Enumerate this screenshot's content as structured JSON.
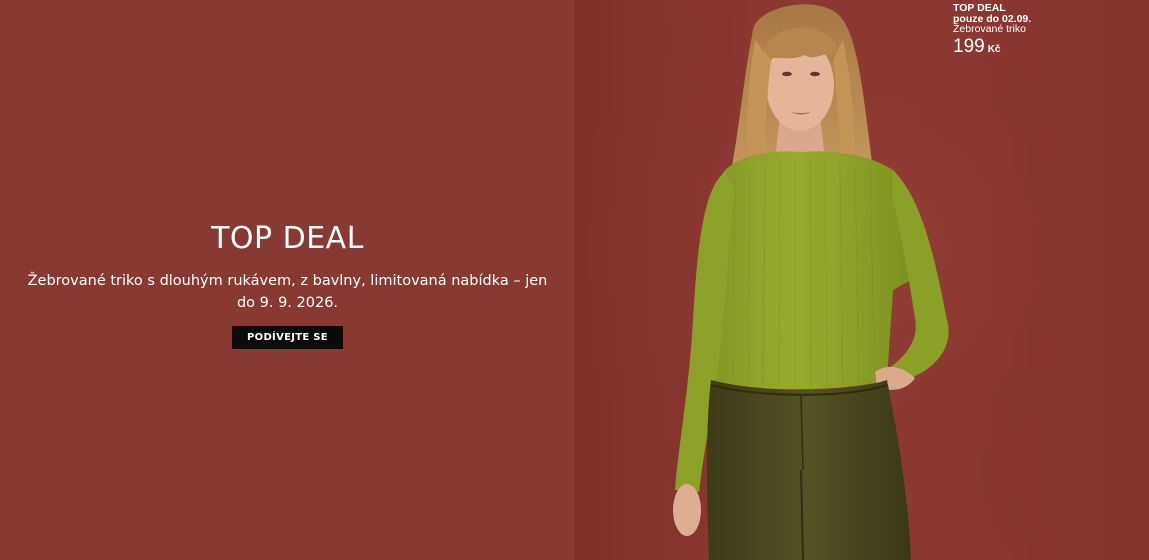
{
  "promo": {
    "headline": "TOP DEAL",
    "description": "Žebrované triko s dlouhým rukávem, z bavlny, limitovaná nabídka – jen do 9. 9. 2026.",
    "cta_label": "PODÍVEJTE SE"
  },
  "price_tag": {
    "badge": "TOP DEAL",
    "validity": "pouze do 02.09.",
    "product_name": "Žebrované triko",
    "price": "199",
    "currency": "Kč"
  },
  "colors": {
    "background": "#883931",
    "top": "#8fa52a",
    "pants": "#4a4a1e",
    "button": "#0b0b0b",
    "text": "#ffffff"
  }
}
